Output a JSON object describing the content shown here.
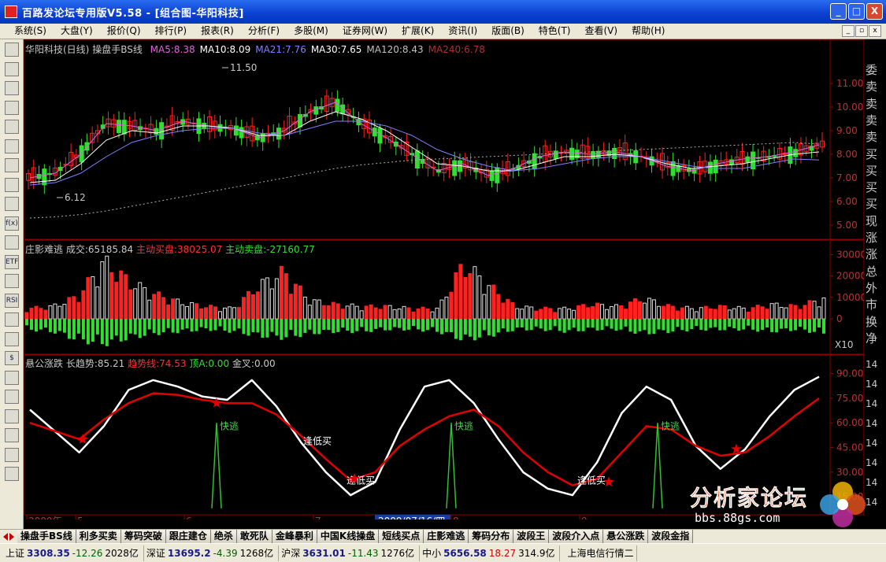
{
  "window": {
    "title": "百路发论坛专用版V5.58 - [组合图-华阳科技]",
    "buttons": [
      "_",
      "□",
      "X"
    ]
  },
  "menu": [
    {
      "label": "系统(S)"
    },
    {
      "label": "大盘(Y)"
    },
    {
      "label": "报价(Q)"
    },
    {
      "label": "排行(P)"
    },
    {
      "label": "报表(R)"
    },
    {
      "label": "分析(F)"
    },
    {
      "label": "多股(M)"
    },
    {
      "label": "证券网(W)"
    },
    {
      "label": "扩展(K)"
    },
    {
      "label": "资讯(I)"
    },
    {
      "label": "版面(B)"
    },
    {
      "label": "特色(T)"
    },
    {
      "label": "查看(V)"
    },
    {
      "label": "帮助(H)"
    }
  ],
  "menu_window_controls": [
    "_",
    "▫",
    "x"
  ],
  "toolbar_icons": [
    "quote-icon",
    "grid-icon",
    "trend-icon",
    "kline-icon",
    "list-icon",
    "report-icon",
    "calendar-icon",
    "mail-icon",
    "people-icon",
    "function-icon",
    "search-icon",
    "etf-icon",
    "wave-icon",
    "rsi-icon",
    "window-icon",
    "table-icon",
    "dollar-icon",
    "tools-icon",
    "export-icon",
    "pencil-icon",
    "move-icon",
    "up-arrow-icon",
    "down-arrow-icon"
  ],
  "toolbar_labels": [
    "",
    "",
    "",
    "",
    "",
    "",
    "",
    "",
    "",
    "f(x)",
    "",
    "ETF",
    "",
    "RSI",
    "",
    "",
    "$",
    "",
    "",
    "",
    "",
    "",
    ""
  ],
  "panes": {
    "price": {
      "stock": "华阳科技(日线)",
      "indicator": "操盘手BS线",
      "ma": [
        {
          "label": "MA5:8.38",
          "color": "#e060e0"
        },
        {
          "label": "MA10:8.09",
          "color": "#ffffff"
        },
        {
          "label": "MA21:7.76",
          "color": "#8080ff"
        },
        {
          "label": "MA30:7.65",
          "color": "#ffffff"
        },
        {
          "label": "MA120:8.43",
          "color": "#c0c0c0"
        },
        {
          "label": "MA240:6.78",
          "color": "#b03030"
        }
      ],
      "high_label": "11.50",
      "low_label": "6.12",
      "yticks": [
        "11.00",
        "10.00",
        "9.00",
        "8.00",
        "7.00",
        "6.00",
        "5.00"
      ]
    },
    "volume": {
      "title": "庄影难逃",
      "deal": "成交:65185.84",
      "buy": "主动买盘:38025.07",
      "sell": "主动卖盘:-27160.77",
      "yticks": [
        "30000",
        "20000",
        "10000",
        "0"
      ],
      "unit": "X10"
    },
    "indicator": {
      "title": "悬公涨跌",
      "long": "长趋势:85.21",
      "trend": "趋势线:74.53",
      "top": "顶A:0.00",
      "cross": "金叉:0.00",
      "yticks": [
        "90.00",
        "75.00",
        "60.00",
        "45.00",
        "30.00",
        "15.00"
      ],
      "annotations": [
        "快逃",
        "快逃",
        "快逃",
        "逢低买",
        "逢低买",
        "逢低买"
      ]
    }
  },
  "chart_data": [
    {
      "type": "bar",
      "title": "华阳科技(日线) 操盘手BS线",
      "ylim": [
        4.6,
        12.0
      ],
      "series": [
        {
          "name": "MA5",
          "values": [
            7.0,
            7.2,
            8.0,
            9.3,
            9.2,
            9.0,
            9.4,
            9.2,
            9.1,
            8.7,
            9.0,
            9.8,
            10.2,
            9.3,
            8.7,
            8.0,
            7.3,
            7.6,
            7.1,
            7.4,
            7.9,
            8.1,
            8.0,
            8.1,
            7.9,
            7.5,
            7.3,
            7.6,
            7.8,
            7.9,
            8.1,
            8.4
          ]
        },
        {
          "name": "MA10",
          "values": [
            6.8,
            6.9,
            7.6,
            8.6,
            9.0,
            8.9,
            9.2,
            9.2,
            9.1,
            8.8,
            8.8,
            9.4,
            9.8,
            9.5,
            9.0,
            8.3,
            7.6,
            7.5,
            7.3,
            7.3,
            7.6,
            7.9,
            7.9,
            8.0,
            7.9,
            7.6,
            7.4,
            7.5,
            7.6,
            7.8,
            8.0,
            8.1
          ]
        },
        {
          "name": "MA21",
          "values": [
            6.7,
            6.8,
            7.2,
            7.9,
            8.5,
            8.8,
            9.0,
            9.1,
            9.1,
            8.9,
            8.8,
            9.1,
            9.4,
            9.4,
            9.2,
            8.8,
            8.2,
            7.8,
            7.5,
            7.3,
            7.4,
            7.6,
            7.8,
            7.9,
            7.9,
            7.7,
            7.5,
            7.4,
            7.4,
            7.6,
            7.8,
            7.76
          ]
        },
        {
          "name": "MA240",
          "values": [
            5.3,
            5.35,
            5.45,
            5.6,
            5.8,
            6.0,
            6.2,
            6.4,
            6.6,
            6.8,
            7.0,
            7.2,
            7.4,
            7.55,
            7.65,
            7.75,
            7.8,
            7.85,
            7.9,
            7.95,
            8.0,
            8.05,
            8.1,
            8.15,
            8.2,
            8.25,
            8.3,
            8.35,
            8.4,
            8.45,
            8.5,
            8.43
          ]
        }
      ]
    },
    {
      "type": "bar",
      "title": "庄影难逃",
      "ylim": [
        -15000,
        32000
      ],
      "series": [
        {
          "name": "主动买盘",
          "values": [
            5000,
            6000,
            11000,
            28000,
            18000,
            12000,
            8000,
            6000,
            5000,
            16000,
            23000,
            9000,
            7000,
            6000,
            6000,
            5000,
            5000,
            27000,
            16000,
            6000,
            5000,
            5000,
            7000,
            6000,
            10000,
            6000,
            5000,
            6000,
            5000,
            7000,
            6000,
            10000
          ]
        },
        {
          "name": "主动卖盘",
          "values": [
            -5000,
            -6000,
            -10000,
            -12000,
            -9000,
            -7000,
            -6000,
            -5000,
            -6000,
            -8000,
            -9000,
            -7000,
            -6000,
            -6000,
            -5000,
            -5000,
            -6000,
            -10000,
            -8000,
            -5000,
            -5000,
            -6000,
            -5000,
            -5000,
            -7000,
            -6000,
            -5000,
            -5000,
            -5000,
            -6000,
            -5000,
            -7000
          ]
        }
      ]
    },
    {
      "type": "line",
      "title": "悬公涨跌",
      "ylim": [
        6,
        96
      ],
      "series": [
        {
          "name": "长趋势",
          "values": [
            68,
            55,
            42,
            58,
            80,
            86,
            82,
            76,
            74,
            86,
            70,
            48,
            30,
            16,
            24,
            56,
            82,
            86,
            72,
            50,
            30,
            20,
            16,
            36,
            66,
            82,
            74,
            46,
            32,
            44,
            64,
            80,
            88
          ]
        },
        {
          "name": "趋势线",
          "values": [
            60,
            55,
            50,
            62,
            72,
            78,
            77,
            74,
            72,
            72,
            65,
            52,
            38,
            25,
            30,
            46,
            56,
            64,
            68,
            58,
            42,
            30,
            22,
            26,
            42,
            58,
            56,
            46,
            40,
            42,
            52,
            64,
            75
          ]
        }
      ]
    }
  ],
  "xaxis": {
    "labels": [
      "2009年",
      "5",
      "6",
      "7",
      "2009/07/16/四",
      "8",
      "9"
    ]
  },
  "info_panel": [
    "委",
    "卖",
    "卖",
    "卖",
    "卖",
    "买",
    "买",
    "买",
    "买",
    "现",
    "涨",
    "涨",
    "总",
    "外",
    "市",
    "换",
    "净"
  ],
  "time_panel": [
    "14",
    "14",
    "14",
    "14",
    "14",
    "14",
    "14",
    "14"
  ],
  "tabs": [
    "操盘手BS线",
    "利多买卖",
    "筹码突破",
    "跟庄建仓",
    "绝杀",
    "敢死队",
    "金峰暴利",
    "中国K线操盘",
    "短线买点",
    "庄影难逃",
    "筹码分布",
    "波段王",
    "波段介入点",
    "悬公涨跌",
    "波段金指"
  ],
  "status": [
    {
      "name": "上证",
      "value": "3308.35",
      "change": "-12.26",
      "volume": "2028亿"
    },
    {
      "name": "深证",
      "value": "13695.2",
      "change": "-4.39",
      "volume": "1268亿"
    },
    {
      "name": "沪深",
      "value": "3631.01",
      "change": "-11.43",
      "volume": "1276亿"
    },
    {
      "name": "中小",
      "value": "5656.58",
      "change": "18.27",
      "volume": "314.9亿"
    }
  ],
  "status_right": "上海电信行情二",
  "watermark": {
    "title": "分析家论坛",
    "url": "bbs.88gs.com"
  },
  "colors": {
    "up": "#ff2020",
    "down": "#30e030",
    "indicator_line": "#ffffff",
    "trend_line": "#e00000",
    "grid": "#8b0000"
  }
}
